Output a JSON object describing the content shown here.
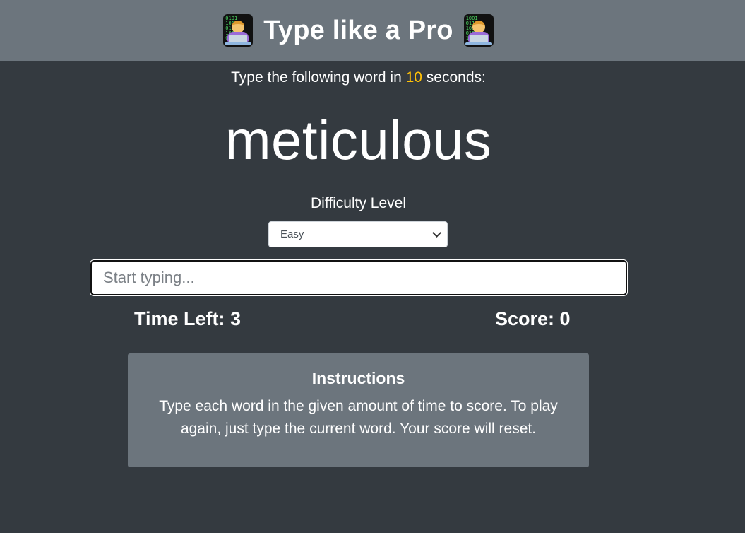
{
  "header": {
    "title": "Type like a Pro",
    "left_icon": "technologist-emoji-icon",
    "right_icon": "technologist-emoji-icon"
  },
  "prompt": {
    "before": "Type the following word in ",
    "seconds": "10",
    "after": " seconds:"
  },
  "current_word": "meticulous",
  "difficulty": {
    "label": "Difficulty Level",
    "selected": "Easy"
  },
  "input": {
    "value": "",
    "placeholder": "Start typing..."
  },
  "stats": {
    "time_left_label": "Time Left: ",
    "time_left_value": "3",
    "score_label": "Score: ",
    "score_value": "0"
  },
  "instructions": {
    "title": "Instructions",
    "text": "Type each word in the given amount of time to score. To play again, just type the current word. Your score will reset."
  },
  "colors": {
    "background": "#343a40",
    "header_bg": "#6c757d",
    "accent_seconds": "#ffc107",
    "panel_bg": "#6c757d"
  }
}
